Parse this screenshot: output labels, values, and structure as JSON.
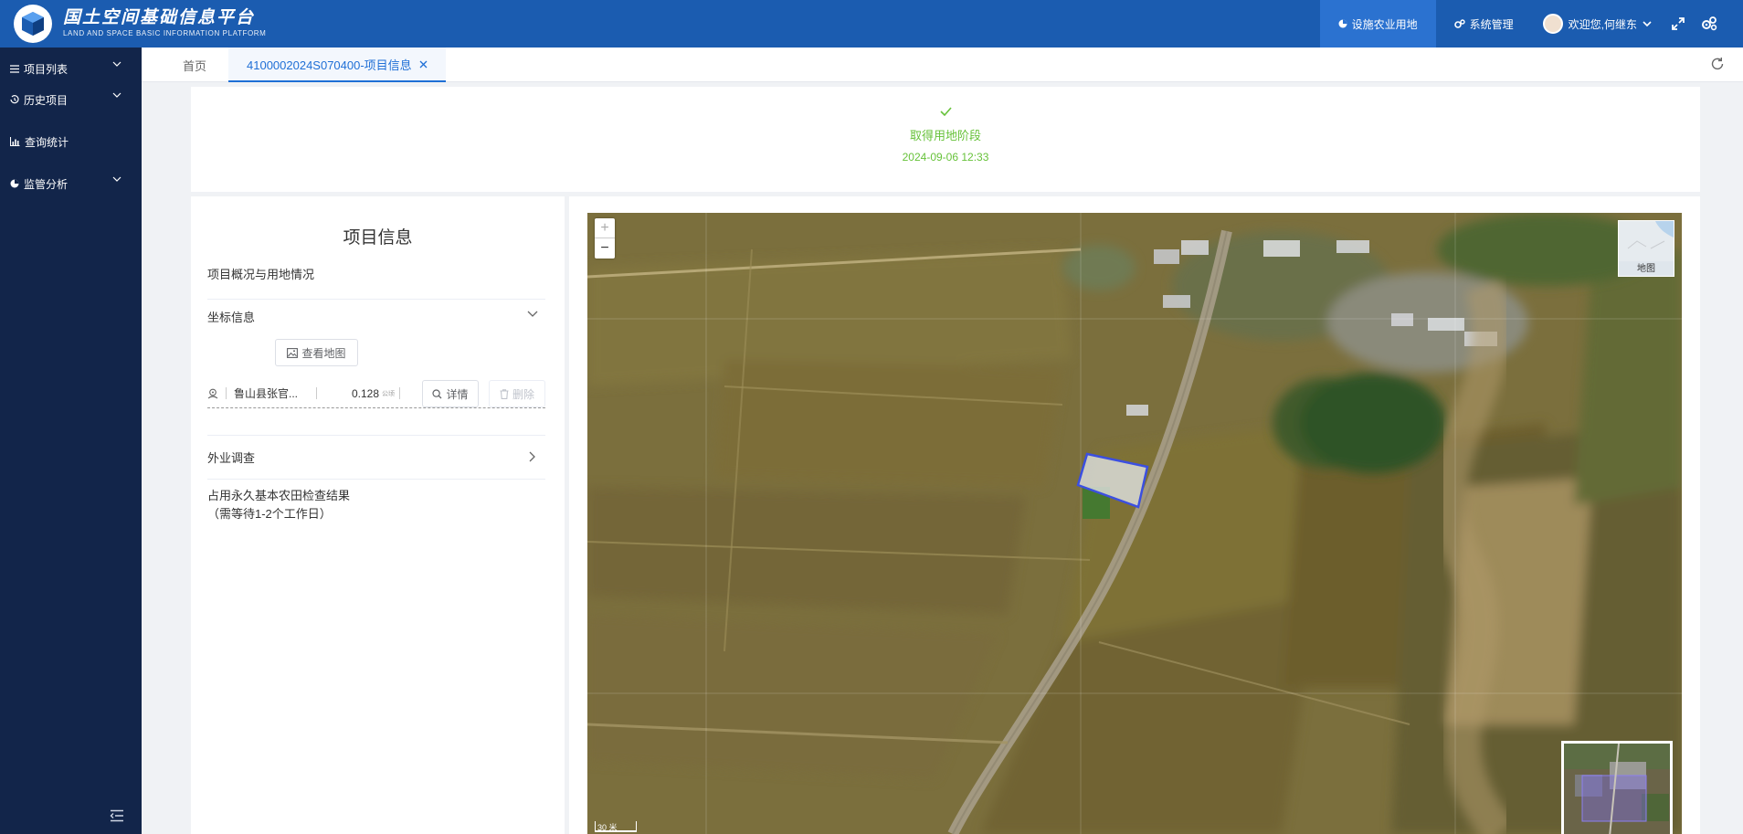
{
  "header": {
    "title_cn": "国土空间基础信息平台",
    "title_en": "LAND AND SPACE BASIC INFORMATION PLATFORM",
    "nav_active": "设施农业用地",
    "nav_system": "系统管理",
    "user_greeting": "欢迎您,何继东"
  },
  "sidebar": {
    "items": [
      {
        "label": "项目列表"
      },
      {
        "label": "历史项目"
      },
      {
        "label": "查询统计"
      },
      {
        "label": "监管分析"
      }
    ]
  },
  "tabs": {
    "home": "首页",
    "active": "4100002024S070400-项目信息"
  },
  "status": {
    "stage": "取得用地阶段",
    "time": "2024-09-06 12:33"
  },
  "info": {
    "title": "项目信息",
    "overview": "项目概况与用地情况",
    "coord_section": "坐标信息",
    "view_map_btn": "查看地图",
    "coord_name": "鲁山县张官...",
    "coord_value": "0.128",
    "coord_unit": "公顷",
    "detail_btn": "详情",
    "delete_btn": "删除",
    "field_survey": "外业调查",
    "farmland_check_line1": "占用永久基本农田检查结果",
    "farmland_check_line2": "（需等待1-2个工作日）"
  },
  "map": {
    "zoom_in": "+",
    "zoom_out": "−",
    "basemap_label": "地图",
    "scale_label": "30 米"
  }
}
